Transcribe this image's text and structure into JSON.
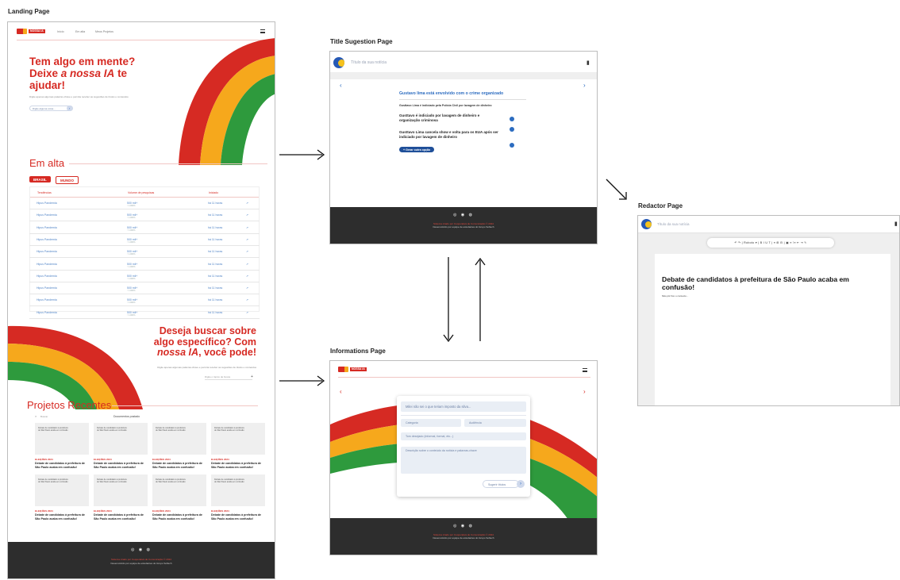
{
  "frames": {
    "landing": {
      "label": "Landing Page",
      "nav": [
        "Início",
        "Em alta",
        "Meus Projetos"
      ],
      "logo_text": "NOSSA IA",
      "hero": {
        "line1": "Tem algo em mente?",
        "line2_pre": "Deixe ",
        "line2_em": "a nossa IA",
        "line2_post": " te",
        "line3": "ajudar!",
        "desc": "Digite apenas algumas palavras-chave e permita receber as sugestões de títulos e conteúdos",
        "input_placeholder": "Digite alguma coisa..."
      },
      "trending": {
        "title": "Em alta",
        "tabs": [
          "BRASIL",
          "MUNDO"
        ],
        "columns": [
          "Tendências",
          "Volume de pesquisas",
          "Iniciado"
        ],
        "rows": [
          {
            "topic": "Hipus Pandemia",
            "volume": "500 mil+",
            "sub": "↑ 1.000%",
            "started": "há 11 horas"
          },
          {
            "topic": "Hipus Pandemia",
            "volume": "500 mil+",
            "sub": "↑ 1.000%",
            "started": "há 11 horas"
          },
          {
            "topic": "Hipus Pandemia",
            "volume": "500 mil+",
            "sub": "↑ 1.000%",
            "started": "há 11 horas"
          },
          {
            "topic": "Hipus Pandemia",
            "volume": "500 mil+",
            "sub": "↑ 1.000%",
            "started": "há 11 horas"
          },
          {
            "topic": "Hipus Pandemia",
            "volume": "500 mil+",
            "sub": "↑ 1.000%",
            "started": "há 11 horas"
          },
          {
            "topic": "Hipus Pandemia",
            "volume": "500 mil+",
            "sub": "↑ 1.000%",
            "started": "há 11 horas"
          },
          {
            "topic": "Hipus Pandemia",
            "volume": "500 mil+",
            "sub": "↑ 1.000%",
            "started": "há 11 horas"
          },
          {
            "topic": "Hipus Pandemia",
            "volume": "500 mil+",
            "sub": "↑ 1.000%",
            "started": "há 11 horas"
          },
          {
            "topic": "Hipus Pandemia",
            "volume": "500 mil+",
            "sub": "↑ 1.000%",
            "started": "há 11 horas"
          },
          {
            "topic": "Hipus Pandemia",
            "volume": "500 mil+",
            "sub": "↑ 1.000%",
            "started": "há 11 horas"
          }
        ]
      },
      "search": {
        "line1": "Deseja buscar sobre",
        "line2": "algo específico? Com",
        "line3_em": "nossa IA",
        "line3_post": ", você pode!",
        "desc": "Digite apenas algumas palavras-chave e permita receber as sugestões de títulos e conteúdos",
        "input_placeholder": "Digite o tópico de busca"
      },
      "recent": {
        "title": "Projetos Recentes",
        "search_placeholder": "Buscar",
        "filter": "Documentos postado",
        "card_thumb": "Debate de candidatos à prefeitura de São Paulo acaba em confusão",
        "card_category": "ELEIÇÕES 2024",
        "card_title": "Debate de candidatos à prefeitura de São Paulo acaba em confusão!"
      },
      "footer": {
        "icons": "◎ ◉ ◍",
        "line1": "Sistema criado por Cooperativa de Comunicação © 2024",
        "line2": "Desenvolvido por equipe de estudantes do Grupo Softech"
      }
    },
    "title_suggestion": {
      "label": "Title Sugestion Page",
      "topbar_placeholder": "Título da sua notícia",
      "heading": "Gustavo lima está envolvido com o crime organizado",
      "lead": "Gusttavo Lima é indiciado pela Polícia Civil por lavagem de dinheiro",
      "items": [
        "Gusttavo é indiciado por lavagem de dinheiro e organização criminosa",
        "Gusttavo Lima cancela show e volta para os EUA após ser indiciado por lavagem de dinheiro"
      ],
      "button": "+ Gerar outra opção"
    },
    "informations": {
      "label": "Informations Page",
      "headline_placeholder": "Milei não sei o que teriam imposto da silva...",
      "category": "Categoria",
      "audience": "Audiência",
      "tone": "Tom desejado (informal, formal, etc...)",
      "description": "Descrição sobre o conteúdo da notícia e palavras-chave",
      "button": "Sugerir títulos"
    },
    "redactor": {
      "label": "Redactor Page",
      "topbar_placeholder": "Título da sua notícia",
      "toolbar": "↶ ↷ | Roboto ▾ | B I U T | ≡ ⊞ ⊟ | ▣ ≡ ⁝≡ ⇤ ⇥ ✎",
      "doc_title": "Debate de candidatos à prefeitura de São Paulo acaba em confusão!",
      "doc_body": "Não pôr fixo o contexto..."
    }
  }
}
